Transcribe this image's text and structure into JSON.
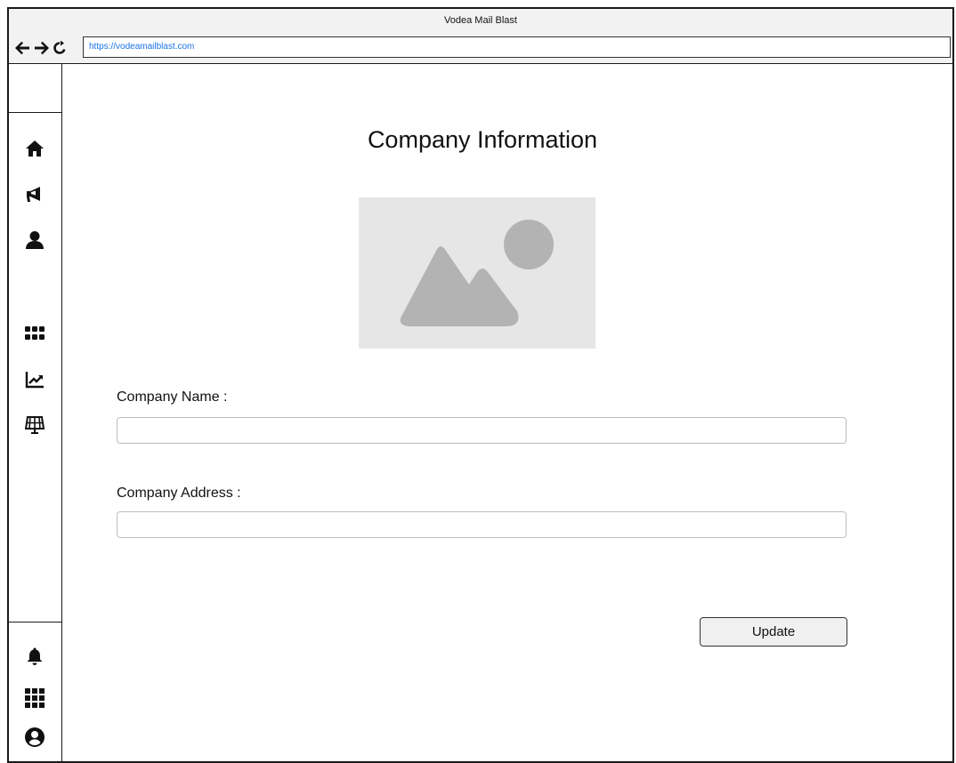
{
  "window": {
    "title": "Vodea Mail Blast"
  },
  "addressbar": {
    "url": "https://vodeamailblast.com",
    "nav_icons": [
      "back-arrow-icon",
      "forward-arrow-icon",
      "reload-icon"
    ]
  },
  "sidebar": {
    "top_icons": [
      "home-icon",
      "megaphone-icon",
      "user-icon"
    ],
    "middle_icons": [
      "grid-icon",
      "chart-line-icon",
      "dashboard-icon"
    ],
    "bottom_icons": [
      "bell-icon",
      "apps-icon",
      "account-circle-icon"
    ]
  },
  "main": {
    "title": "Company Information",
    "image_placeholder": "image-placeholder-icon",
    "fields": [
      {
        "label": "Company Name :",
        "value": "",
        "placeholder": ""
      },
      {
        "label": "Company Address :",
        "value": "",
        "placeholder": ""
      }
    ],
    "update_label": "Update"
  },
  "colors": {
    "url_text": "#1a73e8",
    "chrome_bg": "#f2f2f2",
    "placeholder_bg": "#e6e6e6",
    "placeholder_shape": "#b3b3b3",
    "button_bg": "#f0f0f0"
  }
}
